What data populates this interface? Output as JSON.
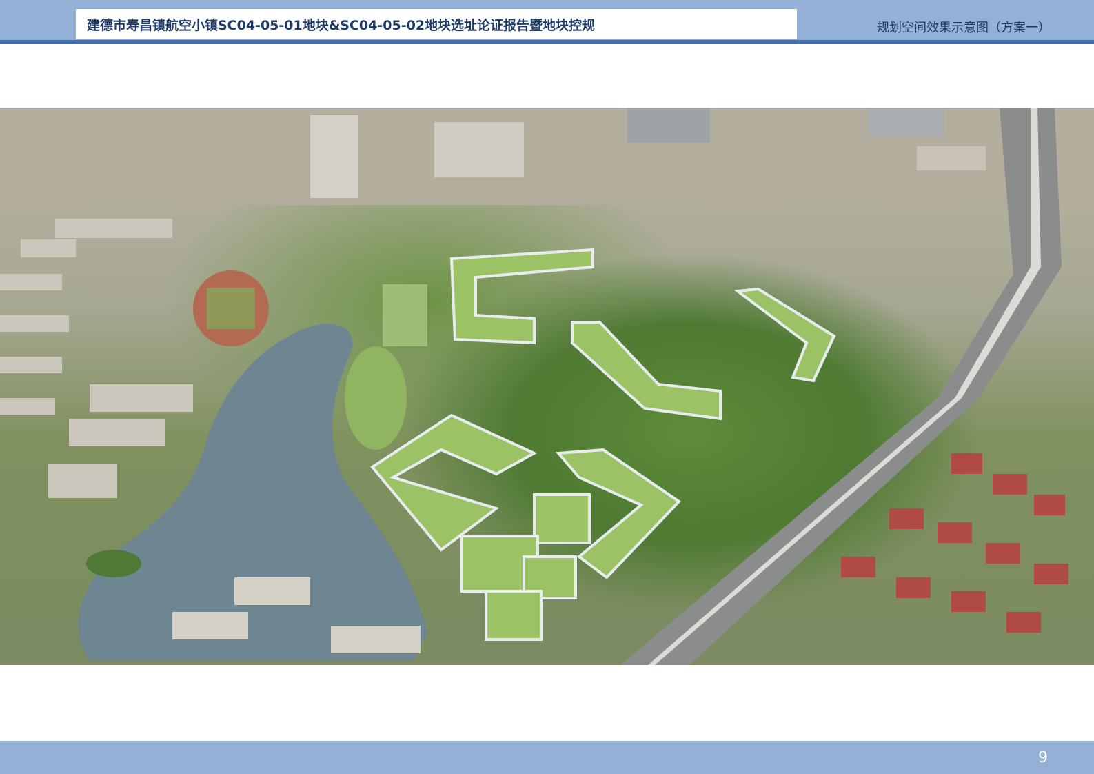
{
  "header": {
    "document_title": "建德市寿昌镇航空小镇SC04-05-01地块&SC04-05-02地块选址论证报告暨地块控规",
    "section_title": "规划空间效果示意图（方案一）"
  },
  "figure": {
    "image_subject": "aerial-rendering-scheme-one"
  },
  "footer": {
    "page_number": "9"
  },
  "colors": {
    "header_band": "#94b0d6",
    "header_rule": "#3f6fb0",
    "title_text": "#1e3a66",
    "footer_band": "#94b0d6"
  }
}
